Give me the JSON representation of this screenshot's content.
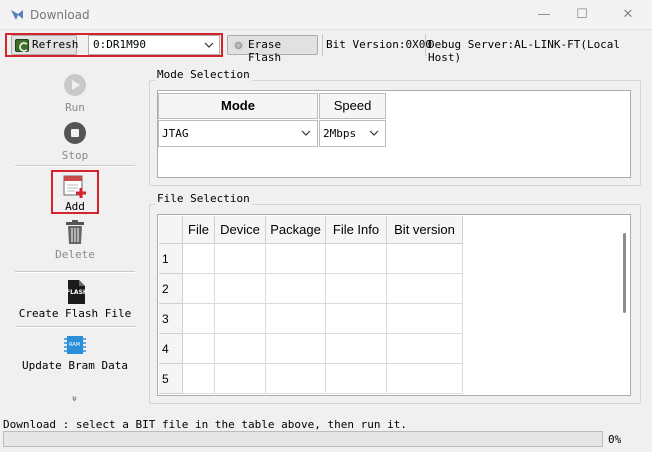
{
  "window": {
    "title": "Download",
    "minimize_glyph": "—",
    "maximize_glyph": "☐",
    "close_glyph": "✕"
  },
  "toolbar": {
    "refresh_label": "Refresh",
    "device_value": "0:DR1M90",
    "erase_label": "Erase Flash",
    "bit_version": "Bit Version:0X00",
    "debug_server": "Debug Server:AL-LINK-FT(Local Host)"
  },
  "sidebar": {
    "run_label": "Run",
    "stop_label": "Stop",
    "add_label": "Add",
    "delete_label": "Delete",
    "create_flash_label": "Create Flash File",
    "flash_icon_text": "FLASH",
    "update_bram_label": "Update Bram Data",
    "ram_icon_text": "RAM",
    "more_glyph": "»"
  },
  "mode_selection": {
    "title": "Mode Selection",
    "headers": [
      "Mode",
      "Speed"
    ],
    "mode_value": "JTAG",
    "speed_value": "2Mbps"
  },
  "file_selection": {
    "title": "File Selection",
    "headers": [
      "File",
      "Device",
      "Package",
      "File Info",
      "Bit version"
    ],
    "rows": [
      "1",
      "2",
      "3",
      "4",
      "5"
    ]
  },
  "status": {
    "message": "Download : select a BIT file in the table above, then run it.",
    "progress_percent": 0,
    "progress_label": "0%"
  },
  "colors": {
    "highlight": "#d4232b",
    "progress": "#06b025"
  }
}
